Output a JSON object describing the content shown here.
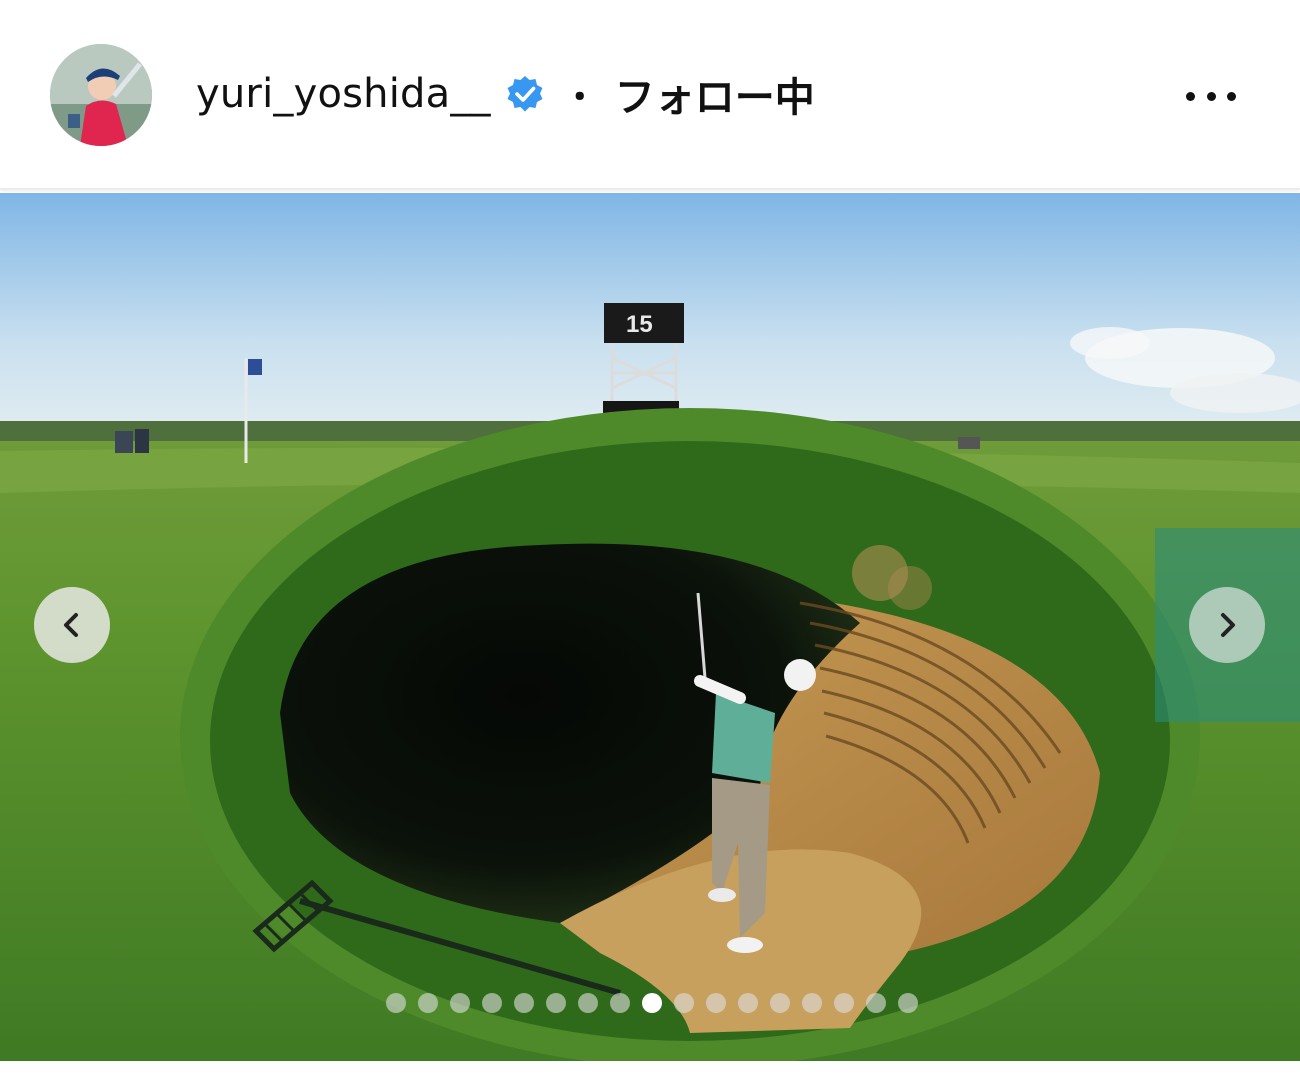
{
  "post": {
    "username": "yuri_yoshida__",
    "verified": true,
    "separator": "・",
    "follow_status": "フォロー中",
    "more_icon": "more-horizontal-icon"
  },
  "photo": {
    "tower_number": "15"
  },
  "carousel": {
    "total": 17,
    "active_index": 8,
    "prev_icon": "chevron-left-icon",
    "next_icon": "chevron-right-icon"
  },
  "colors": {
    "verified_badge": "#3897f0",
    "text": "#111111",
    "active_dot": "#ffffff"
  }
}
